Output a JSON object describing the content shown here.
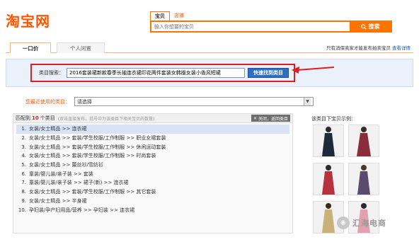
{
  "logo": "淘宝网",
  "search": {
    "tabs": [
      "宝贝",
      "店铺"
    ],
    "placeholder": "输入你想要的宝贝",
    "button_label": "搜索"
  },
  "tabs": {
    "items": [
      "一口价",
      "个人闲置"
    ],
    "right_text": "只有消保卖家才能发布拍卖宝贝",
    "right_link": "查看详情"
  },
  "category_search": {
    "label": "类目搜索：",
    "value": "2016套装裙新款春季长袖连衣裙印花两件套装女韩版女装小香风短裙",
    "button_label": "快速找到类目"
  },
  "recent": {
    "label": "您最近使用的类目：",
    "selected": "请选择"
  },
  "results": {
    "prefix": "匹配到",
    "count": "10",
    "suffix": "个类目",
    "hint": "(双击直接发布，括号中为该类目下相关宝贝的数量)",
    "close_label": "关闭，返回类目",
    "items": [
      "女装/女士精品 >> 连衣裙",
      "女装/女士精品 >> 套装/学生校服/工作制服 >> 职业女裙套装",
      "女装/女士精品 >> 套装/学生校服/工作制服 >> 休闲运动套装",
      "女装/女士精品 >> 套装/学生校服/工作制服 >> 时尚套装",
      "女装/女士精品 >> 蕾丝衫/雪纺衫",
      "童装/婴儿装/亲子装 >> 套装",
      "童装/婴儿装/亲子装 >> 裙子(新) >> 连衣裙",
      "女装/女士精品 >> 套装/学生校服/工作制服 >> 其它套装",
      "女装/女士精品 >> 半身裙",
      "孕妇装/孕产妇用品/营养 >> 孕妇装 >> 连衣裙"
    ]
  },
  "side": {
    "title": "该类目下宝贝示例："
  },
  "watermark": "汇海电商",
  "colors": {
    "accent": "#ff7300",
    "highlight": "#e01e22",
    "panel": "#eaf1fb",
    "button_blue": "#2d6fc5"
  }
}
